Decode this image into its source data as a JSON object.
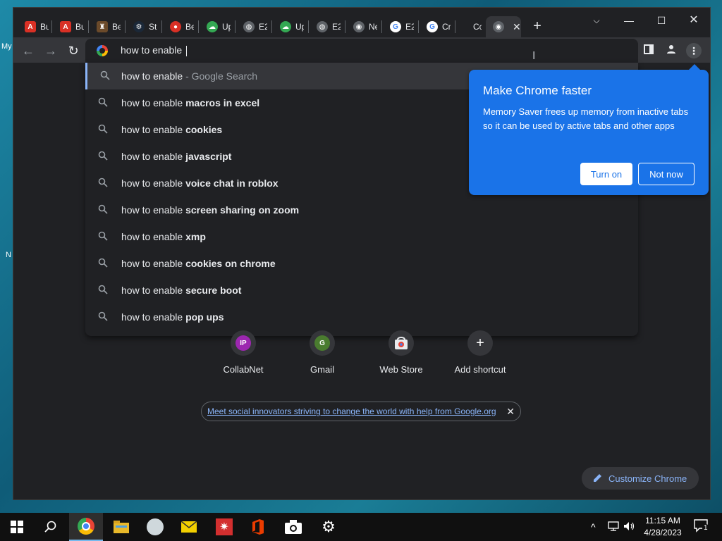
{
  "desktop": {
    "fragments": [
      "My",
      "N"
    ]
  },
  "tabs": [
    {
      "label": "Bu",
      "favicon": "acrobat-icon",
      "color": "#d93025"
    },
    {
      "label": "Bu",
      "favicon": "acrobat-icon",
      "color": "#d93025"
    },
    {
      "label": "Be",
      "favicon": "game-icon",
      "color": "#6b4a2a"
    },
    {
      "label": "St",
      "favicon": "steam-icon",
      "color": "#1b2838"
    },
    {
      "label": "Be",
      "favicon": "gamepad-icon",
      "color": "#d93025"
    },
    {
      "label": "Up",
      "favicon": "cloud-icon",
      "color": "#34a853"
    },
    {
      "label": "E2",
      "favicon": "globe-icon",
      "color": "#5f6368"
    },
    {
      "label": "Up",
      "favicon": "cloud-icon",
      "color": "#34a853"
    },
    {
      "label": "E2",
      "favicon": "globe-icon",
      "color": "#5f6368"
    },
    {
      "label": "Ne",
      "favicon": "chrome-icon",
      "color": "#5f6368"
    },
    {
      "label": "E2",
      "favicon": "google-icon",
      "color": "#ffffff"
    },
    {
      "label": "Cr",
      "favicon": "google-icon",
      "color": "#ffffff"
    },
    {
      "label": "Cc",
      "favicon": "microsoft-icon",
      "color": "#f25022"
    }
  ],
  "omnibox": {
    "value": "how to enable "
  },
  "suggestions": [
    {
      "prefix": "how to enable",
      "bold": "",
      "suffix": " - Google Search"
    },
    {
      "prefix": "how to enable ",
      "bold": "macros in excel",
      "suffix": ""
    },
    {
      "prefix": "how to enable ",
      "bold": "cookies",
      "suffix": ""
    },
    {
      "prefix": "how to enable ",
      "bold": "javascript",
      "suffix": ""
    },
    {
      "prefix": "how to enable ",
      "bold": "voice chat in roblox",
      "suffix": ""
    },
    {
      "prefix": "how to enable ",
      "bold": "screen sharing on zoom",
      "suffix": ""
    },
    {
      "prefix": "how to enable ",
      "bold": "xmp",
      "suffix": ""
    },
    {
      "prefix": "how to enable ",
      "bold": "cookies on chrome",
      "suffix": ""
    },
    {
      "prefix": "how to enable ",
      "bold": "secure boot",
      "suffix": ""
    },
    {
      "prefix": "how to enable ",
      "bold": "pop ups",
      "suffix": ""
    }
  ],
  "bubble": {
    "title": "Make Chrome faster",
    "body": "Memory Saver frees up memory from inactive tabs so it can be used by active tabs and other apps",
    "turn_on": "Turn on",
    "not_now": "Not now"
  },
  "shortcuts": [
    {
      "label": "CollabNet",
      "initials": "IP",
      "color": "#9c27b0"
    },
    {
      "label": "Gmail",
      "initials": "G",
      "color": "#4a7c2f"
    },
    {
      "label": "Web Store",
      "initials": "",
      "color": "#e8eaed"
    },
    {
      "label": "Add shortcut",
      "initials": "+",
      "color": "#35363a"
    }
  ],
  "promo": {
    "link": "Meet social innovators striving to change the world with help from Google.org"
  },
  "customize_label": "Customize Chrome",
  "taskbar": {
    "time": "11:15 AM",
    "date": "4/28/2023",
    "notification_count": "1"
  },
  "colors": {
    "accent_blue": "#1a73e8",
    "link_blue": "#8ab4f8",
    "dark_bg": "#202124"
  }
}
